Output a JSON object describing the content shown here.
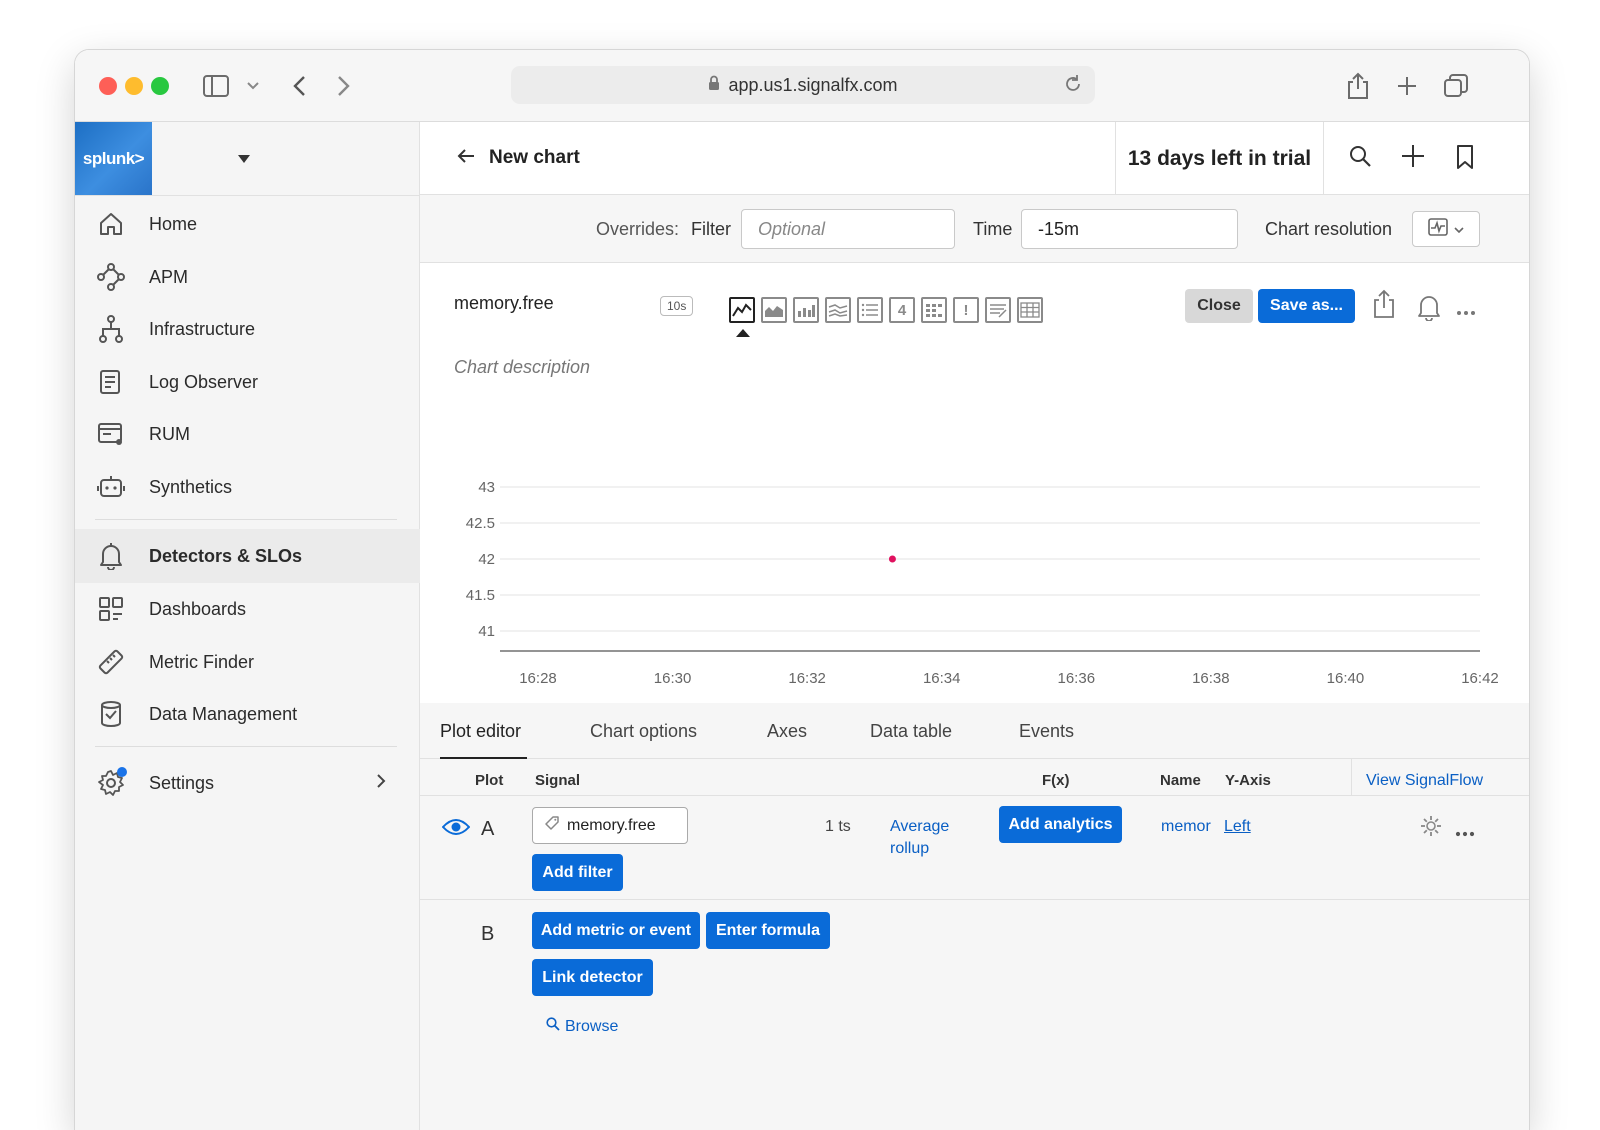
{
  "browser": {
    "url": "app.us1.signalfx.com"
  },
  "sidebar": {
    "logo_text": "splunk>",
    "items": [
      {
        "label": "Home"
      },
      {
        "label": "APM"
      },
      {
        "label": "Infrastructure"
      },
      {
        "label": "Log Observer"
      },
      {
        "label": "RUM"
      },
      {
        "label": "Synthetics"
      },
      {
        "label": "Detectors & SLOs"
      },
      {
        "label": "Dashboards"
      },
      {
        "label": "Metric Finder"
      },
      {
        "label": "Data Management"
      },
      {
        "label": "Settings"
      }
    ]
  },
  "header": {
    "title": "New chart",
    "trial": "13 days left in trial"
  },
  "overrides": {
    "label": "Overrides:",
    "filter_label": "Filter",
    "filter_placeholder": "Optional",
    "time_label": "Time",
    "time_value": "-15m",
    "resolution_label": "Chart resolution"
  },
  "chart": {
    "name": "memory.free",
    "resolution_badge": "10s",
    "description_placeholder": "Chart description",
    "close_label": "Close",
    "save_label": "Save as..."
  },
  "chart_data": {
    "type": "scatter",
    "x": [
      "16:33"
    ],
    "values": [
      42
    ],
    "ylim": [
      41,
      43
    ],
    "yticks": [
      "43",
      "42.5",
      "42",
      "41.5",
      "41"
    ],
    "xticks": [
      "16:28",
      "16:30",
      "16:32",
      "16:34",
      "16:36",
      "16:38",
      "16:40",
      "16:42"
    ],
    "point_color": "#e0115f"
  },
  "tabs": [
    {
      "label": "Plot editor"
    },
    {
      "label": "Chart options"
    },
    {
      "label": "Axes"
    },
    {
      "label": "Data table"
    },
    {
      "label": "Events"
    }
  ],
  "plot_editor": {
    "headers": {
      "plot": "Plot",
      "signal": "Signal",
      "fx": "F(x)",
      "name": "Name",
      "yaxis": "Y-Axis",
      "view_signalflow": "View SignalFlow"
    },
    "row_a": {
      "letter": "A",
      "signal": "memory.free",
      "ts_count": "1 ts",
      "rollup_line1": "Average",
      "rollup_line2": "rollup",
      "add_analytics": "Add analytics",
      "name": "memor",
      "yaxis": "Left",
      "add_filter": "Add filter"
    },
    "row_b": {
      "letter": "B",
      "add_metric": "Add metric or event",
      "enter_formula": "Enter formula",
      "link_detector": "Link detector",
      "browse": "Browse"
    }
  }
}
